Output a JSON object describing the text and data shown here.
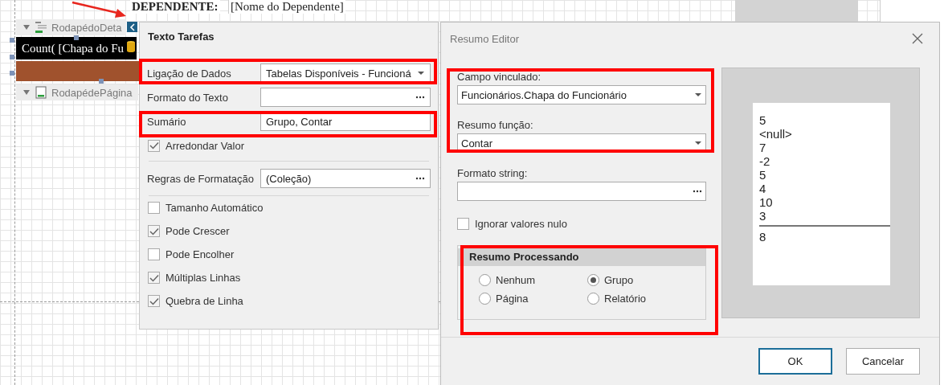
{
  "designer": {
    "header_label": "DEPENDENTE:",
    "header_value": "[Nome do Dependente]",
    "bands": [
      {
        "label": "RodapédoDeta",
        "kind": "detail",
        "expanded": true
      },
      {
        "label": "RodapédePágina",
        "kind": "page",
        "expanded": true
      }
    ],
    "expression": "Count( [Chapa do Fu"
  },
  "tasks_panel": {
    "title": "Texto Tarefas",
    "properties": [
      {
        "label": "Ligação de Dados",
        "value": "Tabelas Disponíveis - Funcioná",
        "kind": "dropdown"
      },
      {
        "label": "Formato do Texto",
        "kind": "ellipsis"
      },
      {
        "label": "Sumário",
        "value": "Grupo, Contar",
        "kind": "text"
      }
    ],
    "round_option": {
      "label": "Arredondar Valor",
      "checked": true
    },
    "rules": {
      "label": "Regras de Formatação",
      "value": "(Coleção)",
      "kind": "ellipsis"
    },
    "options": [
      {
        "label": "Tamanho Automático",
        "checked": false
      },
      {
        "label": "Pode Crescer",
        "checked": true
      },
      {
        "label": "Pode Encolher",
        "checked": false
      },
      {
        "label": "Múltiplas Linhas",
        "checked": true
      },
      {
        "label": "Quebra de Linha",
        "checked": true
      }
    ]
  },
  "dialog": {
    "title": "Resumo Editor",
    "bound_field": {
      "label": "Campo vinculado:",
      "value": "Funcionários.Chapa do Funcionário"
    },
    "summary_function": {
      "label": "Resumo função:",
      "value": "Contar"
    },
    "format_string": {
      "label": "Formato string:"
    },
    "ignore_nulls": {
      "label": "Ignorar valores nulo",
      "checked": false
    },
    "running": {
      "title": "Resumo Processando",
      "options": [
        {
          "label": "Nenhum",
          "selected": false
        },
        {
          "label": "Grupo",
          "selected": true
        },
        {
          "label": "Página",
          "selected": false
        },
        {
          "label": "Relatório",
          "selected": false
        }
      ]
    },
    "preview": {
      "values": [
        "5",
        "<null>",
        "7",
        "-2",
        "5",
        "4",
        "10",
        "3"
      ],
      "total": "8"
    },
    "buttons": [
      {
        "label": "OK",
        "kind": "primary"
      },
      {
        "label": "Cancelar",
        "kind": "secondary"
      }
    ]
  }
}
